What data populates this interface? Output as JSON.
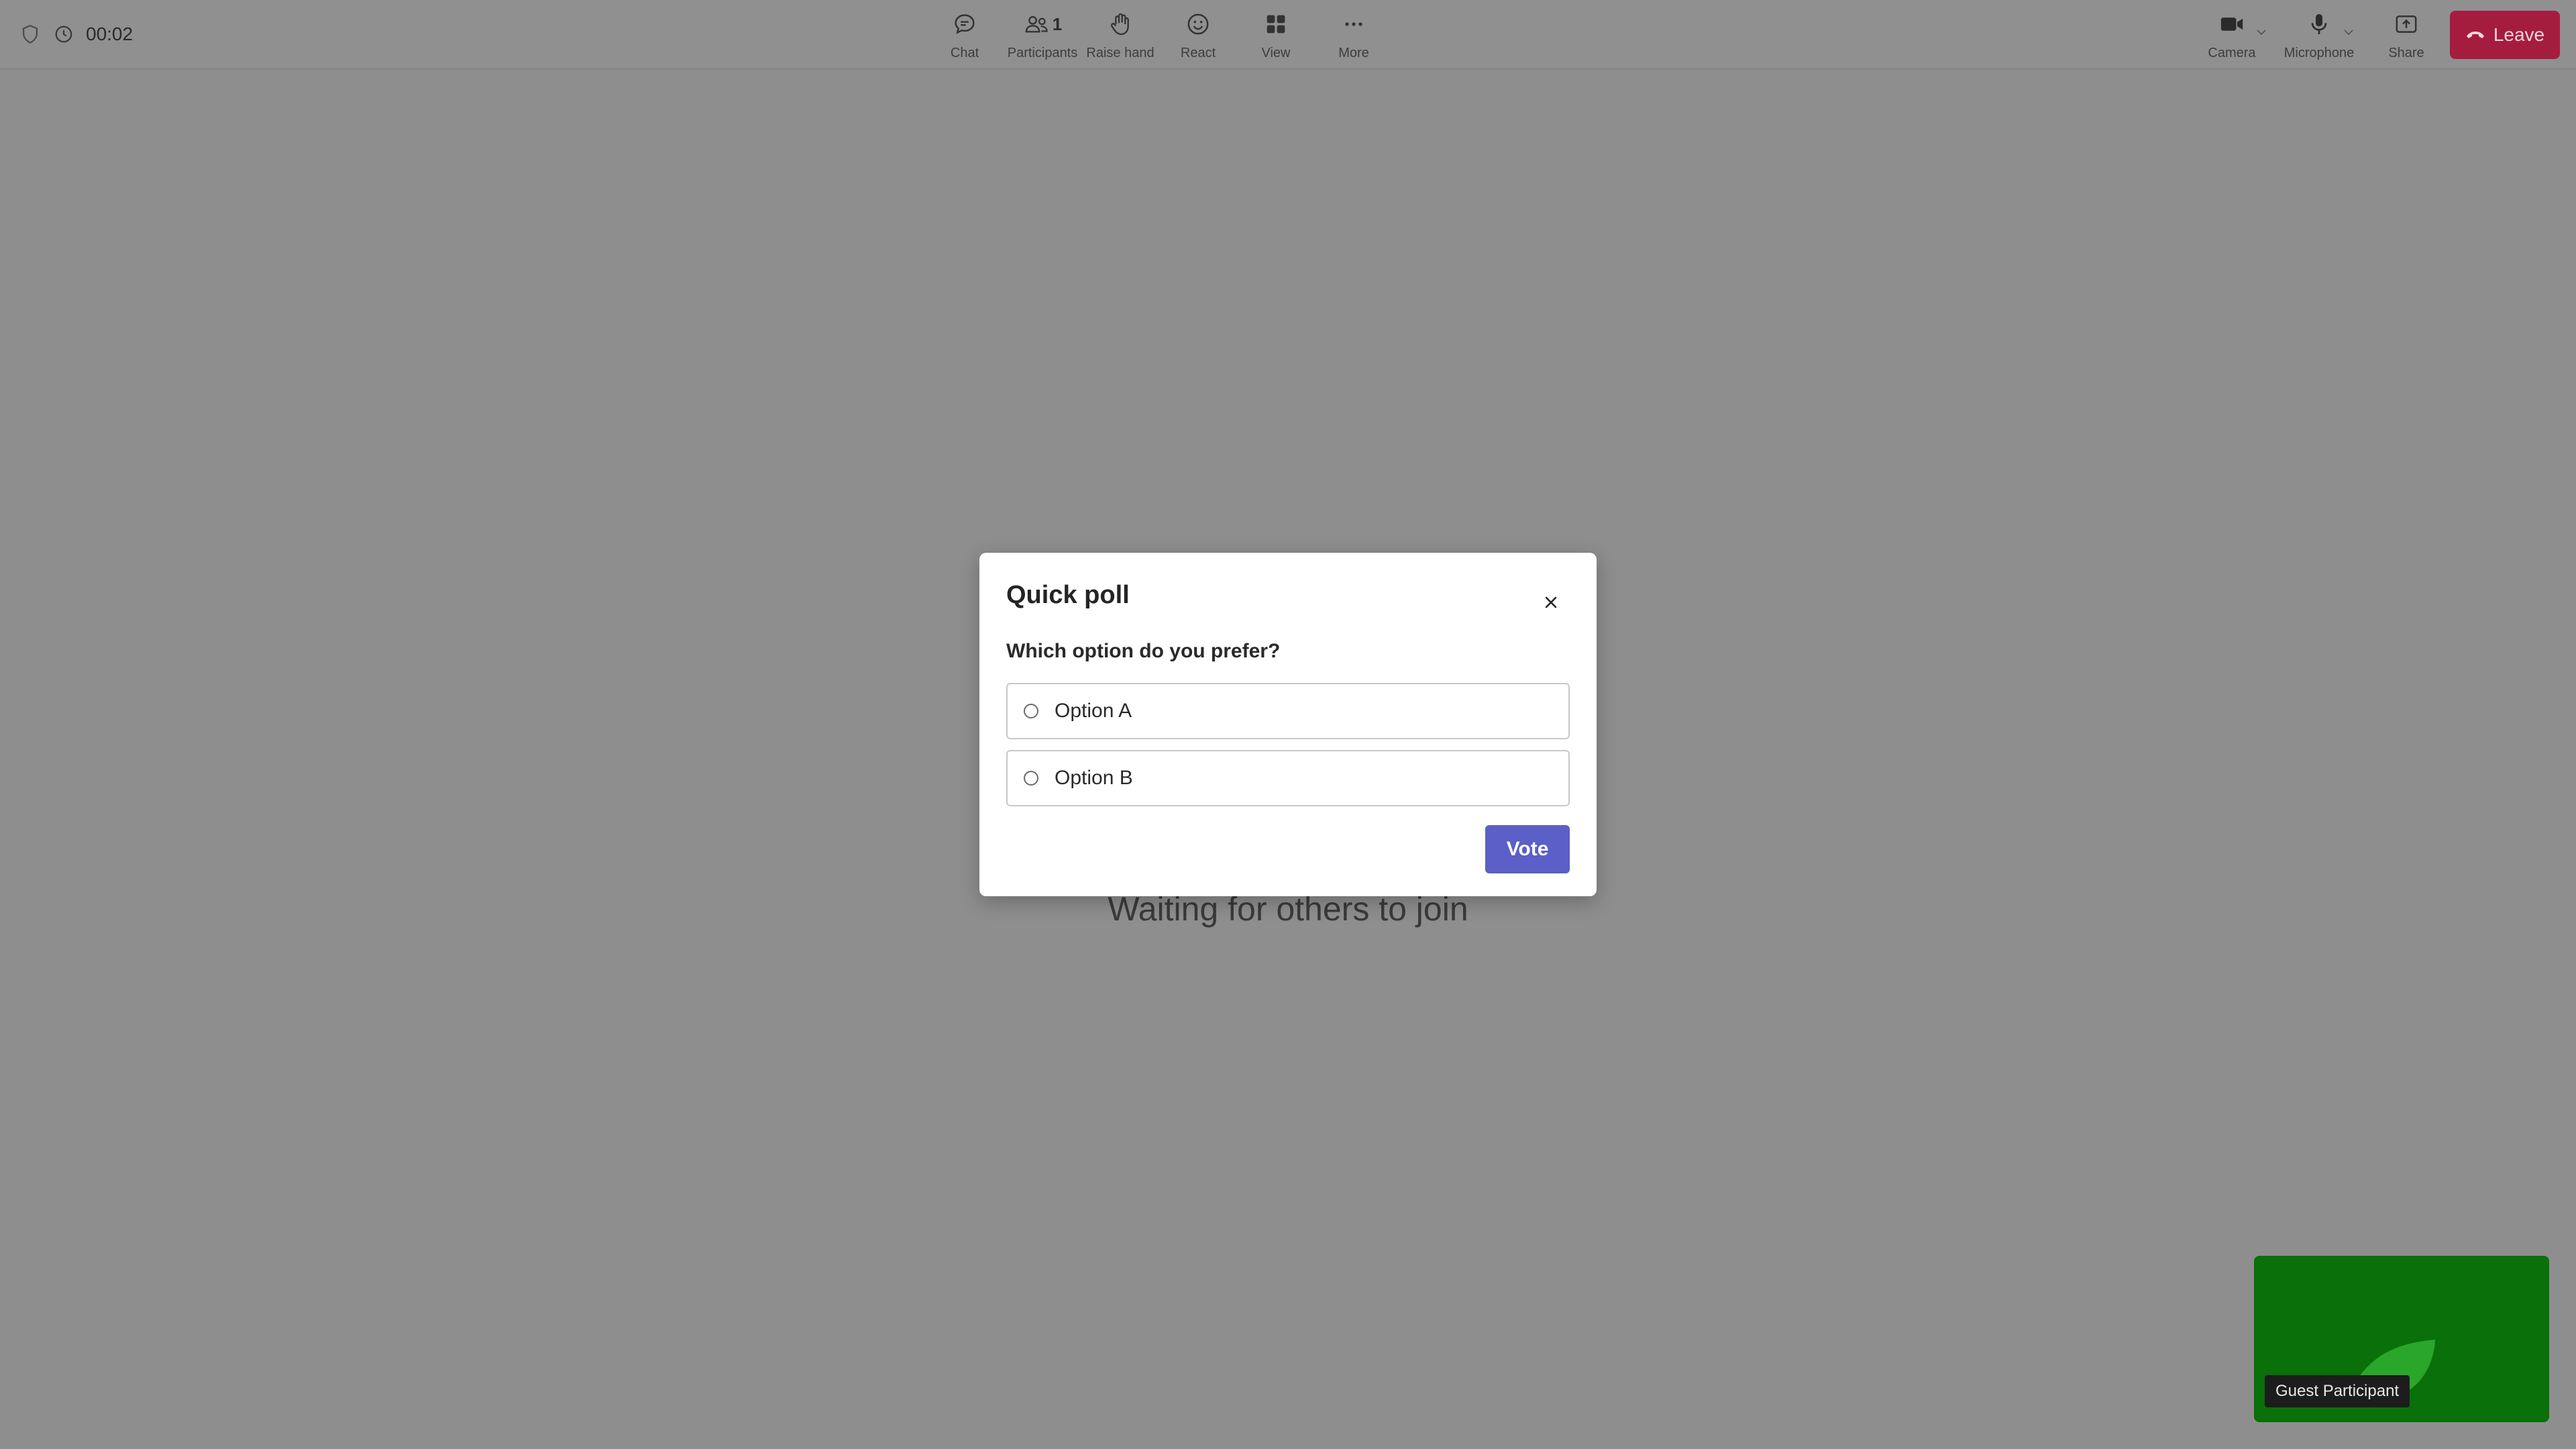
{
  "status": {
    "timer": "00:02"
  },
  "toolbar": {
    "chat_label": "Chat",
    "participants_label": "Participants",
    "participants_count": "1",
    "raise_hand_label": "Raise hand",
    "react_label": "React",
    "view_label": "View",
    "more_label": "More",
    "camera_label": "Camera",
    "microphone_label": "Microphone",
    "share_label": "Share",
    "leave_label": "Leave"
  },
  "stage": {
    "waiting_text": "Waiting for others to join"
  },
  "self_tile": {
    "name": "Guest Participant"
  },
  "poll": {
    "title": "Quick poll",
    "question": "Which option do you prefer?",
    "options": [
      "Option A",
      "Option B"
    ],
    "vote_label": "Vote"
  },
  "colors": {
    "leave": "#a51d3e",
    "vote": "#5b5fc7",
    "self_tile": "#0a700a"
  }
}
